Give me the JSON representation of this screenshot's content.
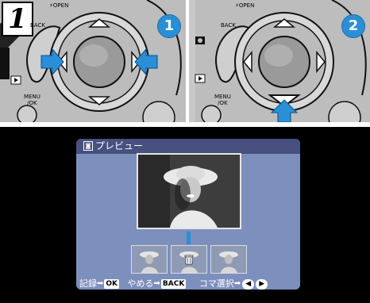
{
  "step": {
    "number": "1",
    "badges": [
      "1",
      "2"
    ]
  },
  "camera": {
    "flash_label": "OPEN",
    "back_label": "BACK",
    "menu_label_line1": "MENU",
    "menu_label_line2": "/OK"
  },
  "screen": {
    "title": "プレビュー",
    "title_icon": "preview-icon",
    "footer": {
      "record_label": "記録",
      "record_key": "OK",
      "cancel_label": "やめる",
      "cancel_key": "BACK",
      "frame_label": "コマ選択",
      "left_key": "◀",
      "right_key": "▶"
    }
  },
  "colors": {
    "accent_blue": "#2a8fd6",
    "screen_bg": "#7d8fbd",
    "header_bg": "#47507f"
  }
}
